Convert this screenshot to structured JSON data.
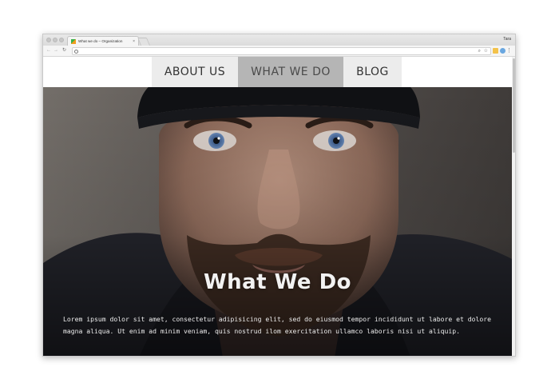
{
  "browser": {
    "tab_title": "What we do – Organization",
    "tab_close": "×",
    "profile_name": "Tara",
    "icons": [
      "back-icon",
      "forward-icon",
      "reload-icon",
      "info-icon",
      "zoom-icon",
      "bookmark-star-icon",
      "menu-dots-icon"
    ],
    "glyphs": {
      "back": "←",
      "forward": "→",
      "reload": "↻",
      "zoom": "⌕",
      "star": "☆",
      "menu": "⋮"
    }
  },
  "site": {
    "nav": [
      {
        "label": "ABOUT US",
        "active": false
      },
      {
        "label": "WHAT WE DO",
        "active": true
      },
      {
        "label": "BLOG",
        "active": false
      }
    ],
    "hero": {
      "title": "What We Do",
      "body": "Lorem ipsum dolor sit amet, consectetur adipisicing elit, sed do eiusmod tempor incididunt ut labore et dolore magna aliqua. Ut enim ad minim veniam, quis nostrud ilom exercitation ullamco laboris nisi ut aliquip."
    }
  },
  "colors": {
    "nav_bg": "#ececec",
    "nav_active_bg": "#b5b5b5",
    "hero_text": "#f2f2f2"
  }
}
